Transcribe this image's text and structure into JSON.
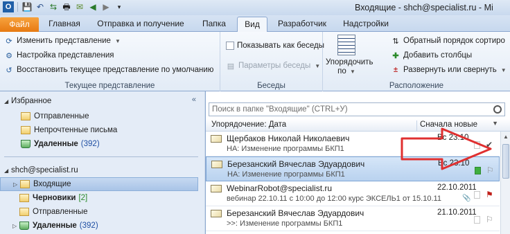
{
  "window": {
    "title": "Входящие - shch@specialist.ru  -  Mi"
  },
  "qat": [
    "save-icon",
    "undo-icon",
    "send-receive-icon",
    "print-icon",
    "folder-icon",
    "back-icon",
    "forward-icon",
    "options-icon"
  ],
  "tabs": [
    {
      "label": "Файл"
    },
    {
      "label": "Главная"
    },
    {
      "label": "Отправка и получение"
    },
    {
      "label": "Папка"
    },
    {
      "label": "Вид"
    },
    {
      "label": "Разработчик"
    },
    {
      "label": "Надстройки"
    }
  ],
  "ribbon": {
    "current_view": {
      "change_view": "Изменить представление",
      "view_settings": "Настройка представления",
      "reset_view": "Восстановить текущее представление по умолчанию",
      "label": "Текущее представление"
    },
    "conversations": {
      "show_as_conversations": "Показывать как беседы",
      "conversation_settings": "Параметры беседы",
      "label": "Беседы"
    },
    "arrangement": {
      "arrange_by": "Упорядочить по",
      "reverse_sort": "Обратный порядок сортиро",
      "add_columns": "Добавить столбцы",
      "expand_collapse": "Развернуть или свернуть",
      "label": "Расположение"
    }
  },
  "folders": {
    "favorites_header": "Избранное",
    "favorites": [
      {
        "name": "Отправленные",
        "count": ""
      },
      {
        "name": "Непрочтенные письма",
        "count": ""
      },
      {
        "name": "Удаленные",
        "count": "(392)"
      }
    ],
    "account": "shch@specialist.ru",
    "account_folders": [
      {
        "name": "Входящие",
        "count": ""
      },
      {
        "name": "Черновики",
        "count": "[2]"
      },
      {
        "name": "Отправленные",
        "count": ""
      },
      {
        "name": "Удаленные",
        "count": "(392)"
      }
    ]
  },
  "mail": {
    "search_placeholder": "Поиск в папке \"Входящие\" (CTRL+У)",
    "arrange_label": "Упорядочение: Дата",
    "sort_label": "Сначала новые",
    "messages": [
      {
        "sender": "Щербаков Николай Николаевич",
        "subject": "НА: Изменение программы БКП1",
        "date": "Вс 23.10"
      },
      {
        "sender": "Березанский Вячеслав Эдуардович",
        "subject": "НА: Изменение программы БКП1",
        "date": "Вс 23.10"
      },
      {
        "sender": "WebinarRobot@specialist.ru",
        "subject": "вебинар 22.10.11 с 10:00 до 12:00  курс ЭКСЕЛЬ1 от 15.10.11",
        "date": "22.10.2011"
      },
      {
        "sender": "Березанский Вячеслав Эдуардович",
        "subject": ">>: Изменение программы БКП1",
        "date": "21.10.2011"
      }
    ]
  }
}
